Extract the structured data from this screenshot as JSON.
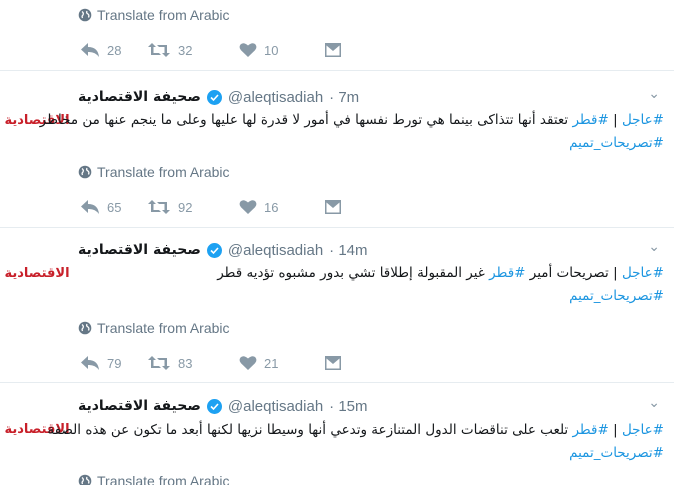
{
  "translate_label": "Translate from Arabic",
  "top_tweet": {
    "replies": "28",
    "retweets": "32",
    "likes": "10"
  },
  "tweets": [
    {
      "logo": "الاقتصادية",
      "author_name": "صحيفة الاقتصادية",
      "handle": "@aleqtisadiah",
      "time": "· 7m",
      "line1_tag1": "#عاجل",
      "line1_sep": "|",
      "line1_tag2": "#قطر",
      "line1_text": "تعتقد أنها تتذاكى بينما هي تورط نفسها في أمور لا قدرة لها عليها وعلى ما ينجم عنها من مخاطر",
      "line2_tag": "#تصريحات_تميم",
      "replies": "65",
      "retweets": "92",
      "likes": "16"
    },
    {
      "logo": "الاقتصادية",
      "author_name": "صحيفة الاقتصادية",
      "handle": "@aleqtisadiah",
      "time": "· 14m",
      "line1_tag1": "#عاجل",
      "line1_sep": "|",
      "line1_pre": "تصريحات أمير",
      "line1_tag2": "#قطر",
      "line1_text": "غير المقبولة إطلاقا تشي بدور مشبوه تؤديه قطر",
      "line2_tag": "#تصريحات_تميم",
      "replies": "79",
      "retweets": "83",
      "likes": "21"
    },
    {
      "logo": "الاقتصادية",
      "author_name": "صحيفة الاقتصادية",
      "handle": "@aleqtisadiah",
      "time": "· 15m",
      "line1_tag1": "#عاجل",
      "line1_sep": "|",
      "line1_tag2": "#قطر",
      "line1_text": "تلعب على تناقضات الدول المتنازعة وتدعي أنها وسيطا نزيها لكنها أبعد ما تكون عن هذه الصفة",
      "line2_tag": "#تصريحات_تميم"
    }
  ],
  "colors": {
    "hashtag": "#1b95e0",
    "icon": "#8899a6",
    "verified": "#1da1f2",
    "logo": "#c8202a"
  },
  "icons": [
    "globe-icon",
    "reply-icon",
    "retweet-icon",
    "like-icon",
    "direct-message-icon",
    "verified-badge-icon",
    "caret-down-icon"
  ]
}
